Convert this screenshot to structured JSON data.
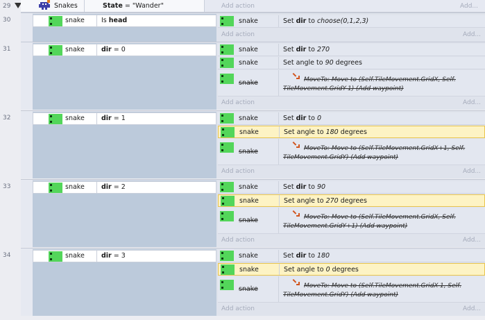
{
  "header": {
    "line": "29",
    "object": "Snakes",
    "condition_var": "State",
    "condition_op": "=",
    "condition_value": "\"Wander\"",
    "add_action": "Add action",
    "add_more": "Add..."
  },
  "events": [
    {
      "line": "30",
      "object": "snake",
      "condition": {
        "pre": "Is ",
        "bold": "head",
        "post": ""
      },
      "actions": [
        {
          "object": "snake",
          "pre": "Set ",
          "bold": "dir",
          "mid": " to ",
          "italic": "choose(0,1,2,3)",
          "post": "",
          "highlight": false
        }
      ],
      "add_action": "Add action",
      "add_more": "Add..."
    },
    {
      "line": "31",
      "object": "snake",
      "condition": {
        "pre": "",
        "bold": "dir",
        "post": " = 0"
      },
      "actions": [
        {
          "object": "snake",
          "pre": "Set ",
          "bold": "dir",
          "mid": " to ",
          "italic": "270",
          "post": "",
          "highlight": false
        },
        {
          "object": "snake",
          "pre": "Set angle to ",
          "bold": "",
          "mid": "",
          "italic": "90",
          "post": " degrees",
          "highlight": false
        }
      ],
      "disabled_action": {
        "object": "snake",
        "line1": "MoveTo: Move to (Self.TileMovement.GridX, Self.",
        "line2": "TileMovement.GridY-1) (Add waypoint)"
      },
      "add_action": "Add action",
      "add_more": "Add..."
    },
    {
      "line": "32",
      "object": "snake",
      "condition": {
        "pre": "",
        "bold": "dir",
        "post": " = 1"
      },
      "actions": [
        {
          "object": "snake",
          "pre": "Set ",
          "bold": "dir",
          "mid": " to ",
          "italic": "0",
          "post": "",
          "highlight": false
        },
        {
          "object": "snake",
          "pre": "Set angle to ",
          "bold": "",
          "mid": "",
          "italic": "180",
          "post": " degrees",
          "highlight": true
        }
      ],
      "disabled_action": {
        "object": "snake",
        "line1": "MoveTo: Move to (Self.TileMovement.GridX+1, Self.",
        "line2": "TileMovement.GridY) (Add waypoint)"
      },
      "add_action": "Add action",
      "add_more": "Add..."
    },
    {
      "line": "33",
      "object": "snake",
      "condition": {
        "pre": "",
        "bold": "dir",
        "post": " = 2"
      },
      "actions": [
        {
          "object": "snake",
          "pre": "Set ",
          "bold": "dir",
          "mid": " to ",
          "italic": "90",
          "post": "",
          "highlight": false
        },
        {
          "object": "snake",
          "pre": "Set angle to ",
          "bold": "",
          "mid": "",
          "italic": "270",
          "post": " degrees",
          "highlight": true
        }
      ],
      "disabled_action": {
        "object": "snake",
        "line1": "MoveTo: Move to (Self.TileMovement.GridX, Self.",
        "line2": "TileMovement.GridY+1) (Add waypoint)"
      },
      "add_action": "Add action",
      "add_more": "Add..."
    },
    {
      "line": "34",
      "object": "snake",
      "condition": {
        "pre": "",
        "bold": "dir",
        "post": " = 3"
      },
      "actions": [
        {
          "object": "snake",
          "pre": "Set ",
          "bold": "dir",
          "mid": " to ",
          "italic": "180",
          "post": "",
          "highlight": false
        },
        {
          "object": "snake",
          "pre": "Set angle to ",
          "bold": "",
          "mid": "",
          "italic": "0",
          "post": " degrees",
          "highlight": true
        }
      ],
      "disabled_action": {
        "object": "snake",
        "line1": "MoveTo: Move to (Self.TileMovement.GridX-1, Self.",
        "line2": "TileMovement.GridY) (Add waypoint)"
      },
      "add_action": "Add action",
      "add_more": "Add..."
    }
  ]
}
